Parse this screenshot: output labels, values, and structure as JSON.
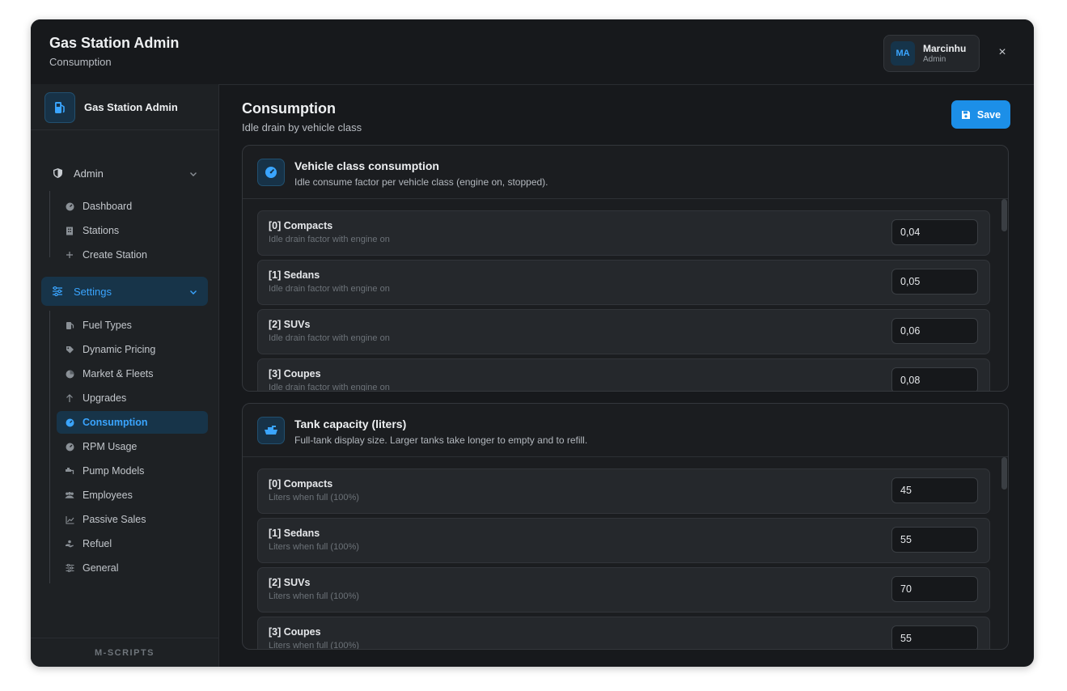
{
  "header": {
    "title": "Gas Station Admin",
    "subtitle": "Consumption",
    "user": {
      "initials": "MA",
      "name": "Marcinhu",
      "role": "Admin"
    },
    "close": "×"
  },
  "sidebar": {
    "brand": "Gas Station Admin",
    "groups": [
      {
        "label": "Admin",
        "items": [
          {
            "label": "Dashboard",
            "icon": "dashboard-icon"
          },
          {
            "label": "Stations",
            "icon": "building-icon"
          },
          {
            "label": "Create Station",
            "icon": "plus-icon"
          }
        ]
      },
      {
        "label": "Settings",
        "items": [
          {
            "label": "Fuel Types",
            "icon": "fuel-icon"
          },
          {
            "label": "Dynamic Pricing",
            "icon": "tag-icon"
          },
          {
            "label": "Market & Fleets",
            "icon": "pie-chart-icon"
          },
          {
            "label": "Upgrades",
            "icon": "arrow-up-icon"
          },
          {
            "label": "Consumption",
            "icon": "gauge-icon",
            "active": true
          },
          {
            "label": "RPM Usage",
            "icon": "gauge-icon"
          },
          {
            "label": "Pump Models",
            "icon": "pump-icon"
          },
          {
            "label": "Employees",
            "icon": "users-icon"
          },
          {
            "label": "Passive Sales",
            "icon": "chart-line-icon"
          },
          {
            "label": "Refuel",
            "icon": "hand-icon"
          },
          {
            "label": "General",
            "icon": "sliders-icon"
          }
        ]
      }
    ],
    "footer": "M-SCRIPTS"
  },
  "main": {
    "title": "Consumption",
    "subtitle": "Idle drain by vehicle class",
    "save_label": "Save",
    "sections": [
      {
        "title": "Vehicle class consumption",
        "description": "Idle consume factor per vehicle class (engine on, stopped).",
        "icon": "gauge-icon",
        "rows": [
          {
            "label": "[0] Compacts",
            "hint": "Idle drain factor with engine on",
            "value": "0,04"
          },
          {
            "label": "[1] Sedans",
            "hint": "Idle drain factor with engine on",
            "value": "0,05"
          },
          {
            "label": "[2] SUVs",
            "hint": "Idle drain factor with engine on",
            "value": "0,06"
          },
          {
            "label": "[3] Coupes",
            "hint": "Idle drain factor with engine on",
            "value": "0,08"
          }
        ]
      },
      {
        "title": "Tank capacity (liters)",
        "description": "Full-tank display size. Larger tanks take longer to empty and to refill.",
        "icon": "tank-icon",
        "rows": [
          {
            "label": "[0] Compacts",
            "hint": "Liters when full (100%)",
            "value": "45"
          },
          {
            "label": "[1] Sedans",
            "hint": "Liters when full (100%)",
            "value": "55"
          },
          {
            "label": "[2] SUVs",
            "hint": "Liters when full (100%)",
            "value": "70"
          },
          {
            "label": "[3] Coupes",
            "hint": "Liters when full (100%)",
            "value": "55"
          }
        ]
      }
    ]
  },
  "colors": {
    "accent": "#1c8fe8",
    "accent_text": "#3aa5ff",
    "background": "#17191c"
  }
}
